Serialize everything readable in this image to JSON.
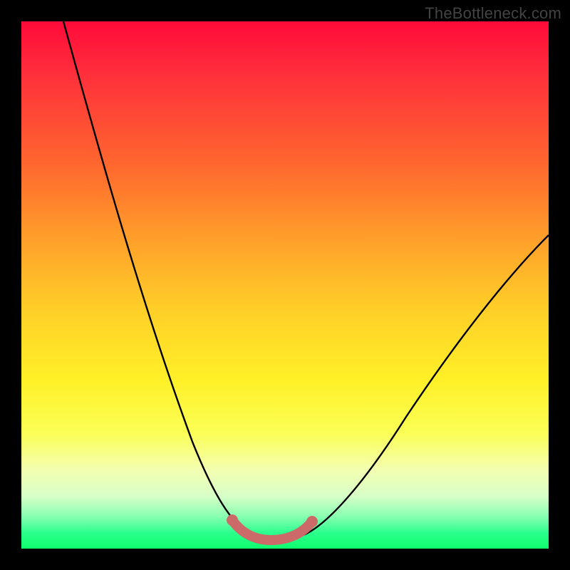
{
  "watermark": "TheBottleneck.com",
  "colors": {
    "frame": "#000000",
    "gradient_top": "#ff0a3a",
    "gradient_bottom": "#0fff6e",
    "curve": "#000000",
    "marker": "#cc6a6a"
  },
  "chart_data": {
    "type": "line",
    "title": "",
    "xlabel": "",
    "ylabel": "",
    "xlim": [
      0,
      100
    ],
    "ylim": [
      0,
      100
    ],
    "grid": false,
    "series": [
      {
        "name": "bottleneck-curve",
        "x": [
          8,
          10,
          12,
          15,
          18,
          21,
          24,
          27,
          30,
          33,
          35,
          37,
          39,
          41,
          43,
          45,
          47,
          50,
          55,
          60,
          65,
          70,
          75,
          80,
          85,
          90,
          95,
          100
        ],
        "y": [
          100,
          93,
          86,
          76,
          67,
          58,
          50,
          42,
          34,
          27,
          22,
          17,
          12,
          8,
          5,
          3,
          2,
          1.5,
          2,
          5,
          10,
          16,
          22,
          29,
          35,
          42,
          48,
          54
        ]
      },
      {
        "name": "optimal-band",
        "x": [
          41,
          43,
          45,
          47,
          49,
          51,
          53,
          55
        ],
        "y": [
          4,
          2.5,
          2,
          1.7,
          1.7,
          2,
          2.5,
          4
        ]
      }
    ],
    "annotations": []
  }
}
